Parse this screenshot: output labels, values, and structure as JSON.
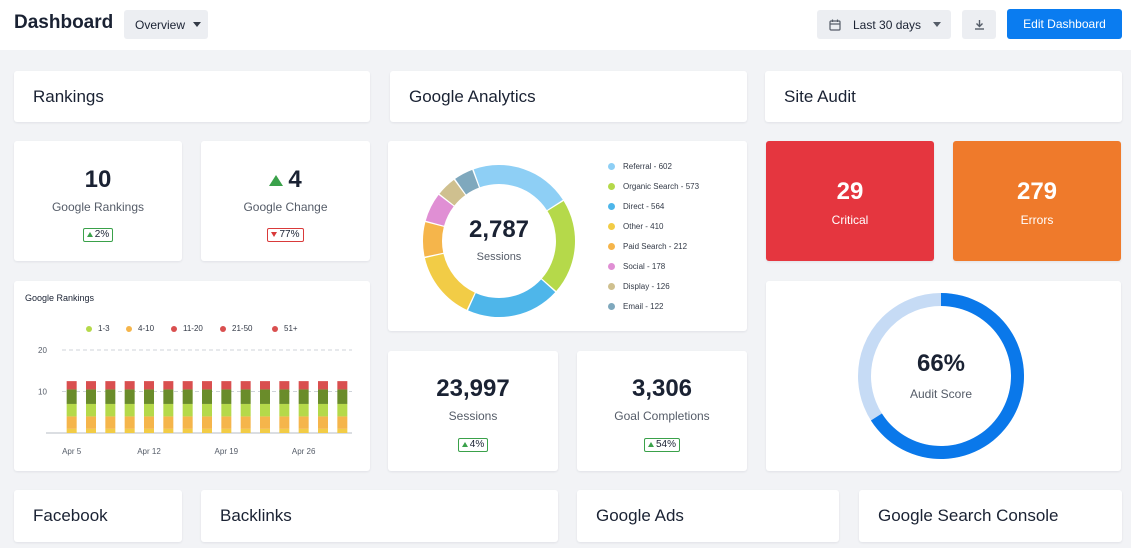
{
  "header": {
    "title": "Dashboard",
    "view_select": "Overview",
    "date_range": "Last 30 days",
    "download_icon": "download-icon",
    "calendar_icon": "calendar-icon",
    "edit_button": "Edit Dashboard",
    "accent_color": "#0a7cf0"
  },
  "sections": {
    "rankings": "Rankings",
    "google_analytics": "Google Analytics",
    "site_audit": "Site Audit",
    "facebook": "Facebook",
    "backlinks": "Backlinks",
    "google_ads": "Google Ads",
    "google_search_console": "Google Search Console"
  },
  "rankings": {
    "google_rankings": {
      "value": "10",
      "label": "Google Rankings",
      "badge": "2%",
      "trend": "up"
    },
    "google_change": {
      "value": "4",
      "label": "Google Change",
      "badge": "77%",
      "trend": "down"
    }
  },
  "analytics": {
    "donut_total": "2,787",
    "donut_label": "Sessions",
    "sources": [
      {
        "label": "Referral - 602",
        "value": 602,
        "color": "#8ecff5"
      },
      {
        "label": "Organic Search - 573",
        "value": 573,
        "color": "#b5d94a"
      },
      {
        "label": "Direct - 564",
        "value": 564,
        "color": "#4eb6ea"
      },
      {
        "label": "Other - 410",
        "value": 410,
        "color": "#f2cc46"
      },
      {
        "label": "Paid Search - 212",
        "value": 212,
        "color": "#f5b54b"
      },
      {
        "label": "Social - 178",
        "value": 178,
        "color": "#e08fd4"
      },
      {
        "label": "Display - 126",
        "value": 126,
        "color": "#cfc08f"
      },
      {
        "label": "Email - 122",
        "value": 122,
        "color": "#7fa8bd"
      }
    ],
    "sessions": {
      "value": "23,997",
      "label": "Sessions",
      "badge": "4%",
      "trend": "up"
    },
    "goal_completions": {
      "value": "3,306",
      "label": "Goal Completions",
      "badge": "54%",
      "trend": "up"
    }
  },
  "site_audit": {
    "critical": {
      "value": "29",
      "label": "Critical",
      "color": "#e5363f"
    },
    "errors": {
      "value": "279",
      "label": "Errors",
      "color": "#ef7a2b"
    },
    "audit_score": {
      "value": "66%",
      "label": "Audit Score",
      "percent": 66,
      "fill_color": "#0a78ea",
      "track_color": "#c6dbf5"
    }
  },
  "chart_data": {
    "type": "bar",
    "title": "Google Rankings",
    "xlabel": "",
    "ylabel": "",
    "ylim": [
      0,
      20
    ],
    "yticks": [
      10,
      20
    ],
    "grid": true,
    "legend_position": "top",
    "x_tick_labels": [
      "Apr 5",
      "Apr 12",
      "Apr 19",
      "Apr 26"
    ],
    "x_tick_index": [
      0,
      4,
      8,
      12
    ],
    "stacked": true,
    "categories": [
      "1",
      "2",
      "3",
      "4",
      "5",
      "6",
      "7",
      "8",
      "9",
      "10",
      "11",
      "12",
      "13",
      "14",
      "15"
    ],
    "series": [
      {
        "name": "1-3",
        "color": "#f2cc46",
        "values": [
          1,
          1,
          1,
          1,
          1,
          1,
          1,
          1,
          1,
          1,
          1,
          1,
          1,
          1,
          1
        ]
      },
      {
        "name": "4-10",
        "color": "#f5b54b",
        "values": [
          3,
          3,
          3,
          3,
          3,
          3,
          3,
          3,
          3,
          3,
          3,
          3,
          3,
          3,
          3
        ]
      },
      {
        "name": "11-20",
        "color": "#b5d94a",
        "values": [
          3,
          3,
          3,
          3,
          3,
          3,
          3,
          3,
          3,
          3,
          3,
          3,
          3,
          3,
          3
        ]
      },
      {
        "name": "21-50",
        "color": "#6a8c2a",
        "values": [
          3.5,
          3.5,
          3.5,
          3.5,
          3.5,
          3.5,
          3.5,
          3.5,
          3.5,
          3.5,
          3.5,
          3.5,
          3.5,
          3.5,
          3.5
        ]
      },
      {
        "name": "51+",
        "color": "#d94f4f",
        "values": [
          2,
          2,
          2,
          2,
          2,
          2,
          2,
          2,
          2,
          2,
          2,
          2,
          2,
          2,
          2
        ]
      }
    ],
    "legend": [
      {
        "name": "1-3",
        "color": "#b5d94a"
      },
      {
        "name": "4-10",
        "color": "#f5b54b"
      },
      {
        "name": "11-20",
        "color": "#d94f4f"
      },
      {
        "name": "21-50",
        "color": "#d94f4f"
      },
      {
        "name": "51+",
        "color": "#d94f4f"
      }
    ]
  }
}
